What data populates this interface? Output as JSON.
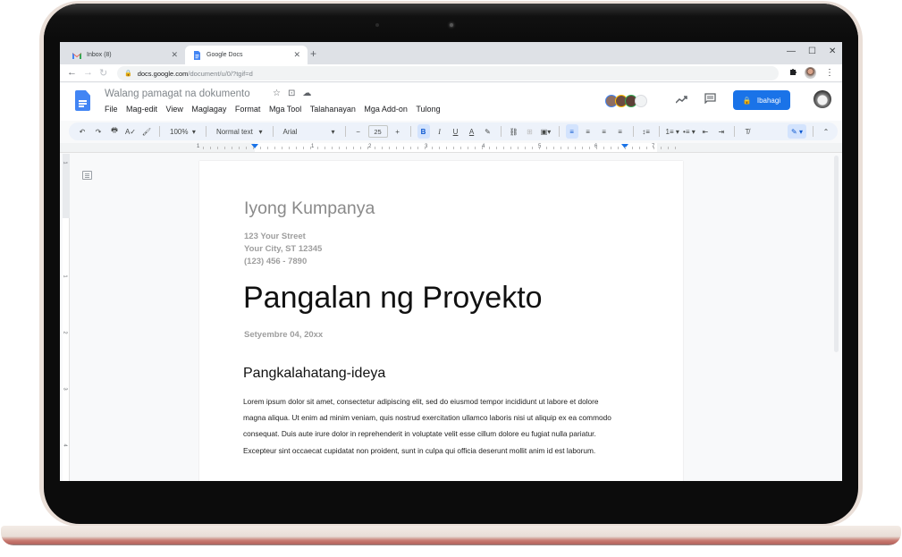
{
  "browser": {
    "tabs": [
      {
        "label": "Inbox (8)",
        "icon": "gmail-icon",
        "active": false
      },
      {
        "label": "Google Docs",
        "icon": "docs-icon",
        "active": true
      }
    ],
    "new_tab": "+",
    "window_controls": {
      "minimize": "—",
      "maximize": "☐",
      "close": "✕"
    },
    "nav": {
      "back": "←",
      "forward": "→",
      "reload": "↻"
    },
    "url_domain": "docs.google.com",
    "url_path": "/document/u/0/?tgif=d",
    "extensions_icon": "puzzle-icon",
    "menu_icon": "⋮"
  },
  "docs": {
    "title": "Walang pamagat na dokumento",
    "title_icons": {
      "star": "☆",
      "move": "⊡",
      "cloud": "☁"
    },
    "menu": [
      "File",
      "Mag-edit",
      "View",
      "Maglagay",
      "Format",
      "Mga Tool",
      "Talahanayan",
      "Mga Add-on",
      "Tulong"
    ],
    "share_label": "Ibahagi",
    "share_color": "#1a73e8",
    "collaborators": [
      {
        "ring": "#4285f4",
        "fill": "#8d6e63"
      },
      {
        "ring": "#fbbc04",
        "fill": "#6d4c41"
      },
      {
        "ring": "#34a853",
        "fill": "#5d4037"
      },
      {
        "ring": "#dadce0",
        "fill": "#f1f3f4"
      }
    ]
  },
  "toolbar": {
    "undo": "↶",
    "redo": "↷",
    "print": "🖶",
    "spellcheck": "A✓",
    "paint_format": "🖌",
    "zoom": "100%",
    "style": "Normal text",
    "font": "Arial",
    "font_size_minus": "−",
    "font_size": "25",
    "font_size_plus": "+",
    "bold": "B",
    "italic": "I",
    "underline": "U",
    "text_color": "A",
    "highlight": "✎",
    "link": "⛓",
    "comment": "⊞",
    "image": "▣",
    "align_left": "≡",
    "align_center": "≡",
    "align_right": "≡",
    "justify": "≡",
    "line_spacing": "↕≡",
    "numbered_list": "1≡",
    "bulleted_list": "•≡",
    "decrease_indent": "⇤",
    "increase_indent": "⇥",
    "clear_format": "T̸",
    "editing_mode": "✎",
    "collapse": "⌃",
    "dropdown": "▾"
  },
  "ruler": {
    "h_labels": [
      "1",
      "1",
      "2",
      "3",
      "4",
      "5",
      "6",
      "7"
    ],
    "v_labels": [
      "1",
      "1",
      "2",
      "3",
      "4"
    ]
  },
  "document": {
    "company": "Iyong Kumpanya",
    "address_lines": [
      "123 Your Street",
      "Your City, ST 12345",
      "(123) 456 - 7890"
    ],
    "project_title": "Pangalan ng Proyekto",
    "date": "Setyembre 04, 20xx",
    "section_heading": "Pangkalahatang-ideya",
    "body_lines": [
      "Lorem ipsum dolor sit amet, consectetur adipiscing elit, sed do eiusmod tempor incididunt ut labore et dolore",
      "magna aliqua. Ut enim ad minim veniam, quis nostrud exercitation ullamco laboris nisi ut aliquip ex ea commodo",
      "consequat. Duis aute irure dolor in reprehenderit in voluptate velit esse cillum dolore eu fugiat nulla pariatur.",
      "Excepteur sint occaecat cupidatat non proident, sunt in culpa qui officia deserunt mollit anim id est laborum."
    ]
  }
}
